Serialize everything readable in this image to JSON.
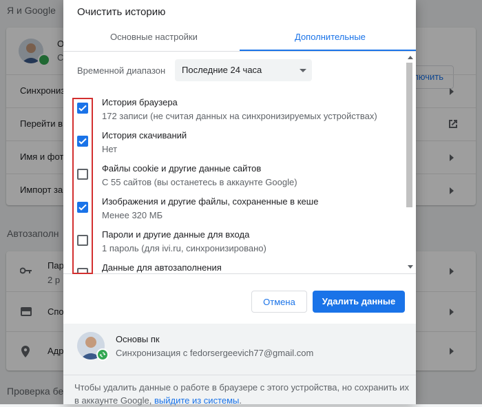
{
  "background": {
    "section_account": "Я и Google",
    "account_card": {
      "name_partial": "О",
      "sub_partial": "С",
      "action_button": "лючить"
    },
    "rows": [
      {
        "label": "Синхрониз"
      },
      {
        "label": "Перейти в"
      },
      {
        "label": "Имя и фот"
      },
      {
        "label": "Импорт за"
      }
    ],
    "section_autofill": "Автозаполн",
    "autofill_rows": [
      {
        "label": "Пар",
        "sub": "2 р"
      },
      {
        "label": "Спо"
      },
      {
        "label": "Адр"
      }
    ],
    "section_security": "Проверка бе"
  },
  "dialog": {
    "title": "Очистить историю",
    "tabs": [
      {
        "label": "Основные настройки",
        "active": false
      },
      {
        "label": "Дополнительные",
        "active": true
      }
    ],
    "time_range": {
      "label": "Временной диапазон",
      "value": "Последние 24 часа"
    },
    "items": [
      {
        "title": "История браузера",
        "sub": "172 записи (не считая данных на синхронизируемых устройствах)",
        "checked": true
      },
      {
        "title": "История скачиваний",
        "sub": "Нет",
        "checked": true
      },
      {
        "title": "Файлы cookie и другие данные сайтов",
        "sub": "С 55 сайтов (вы останетесь в аккаунте Google)",
        "checked": false
      },
      {
        "title": "Изображения и другие файлы, сохраненные в кеше",
        "sub": "Менее 320 МБ",
        "checked": true
      },
      {
        "title": "Пароли и другие данные для входа",
        "sub": "1 пароль (для ivi.ru, синхронизировано)",
        "checked": false
      },
      {
        "title": "Данные для автозаполнения",
        "sub": "",
        "checked": false
      }
    ],
    "cancel_label": "Отмена",
    "delete_label": "Удалить данные",
    "account": {
      "name": "Основы пк",
      "sync_text": "Синхронизация с fedorsergeevich77@gmail.com"
    },
    "note": {
      "text": "Чтобы удалить данные о работе в браузере с этого устройства, но сохранить их в аккаунте Google, ",
      "link": "выйдите из системы",
      "end": "."
    }
  },
  "colors": {
    "accent": "#1a73e8",
    "highlight_box": "#d32f2f",
    "sync_green": "#34a853"
  }
}
